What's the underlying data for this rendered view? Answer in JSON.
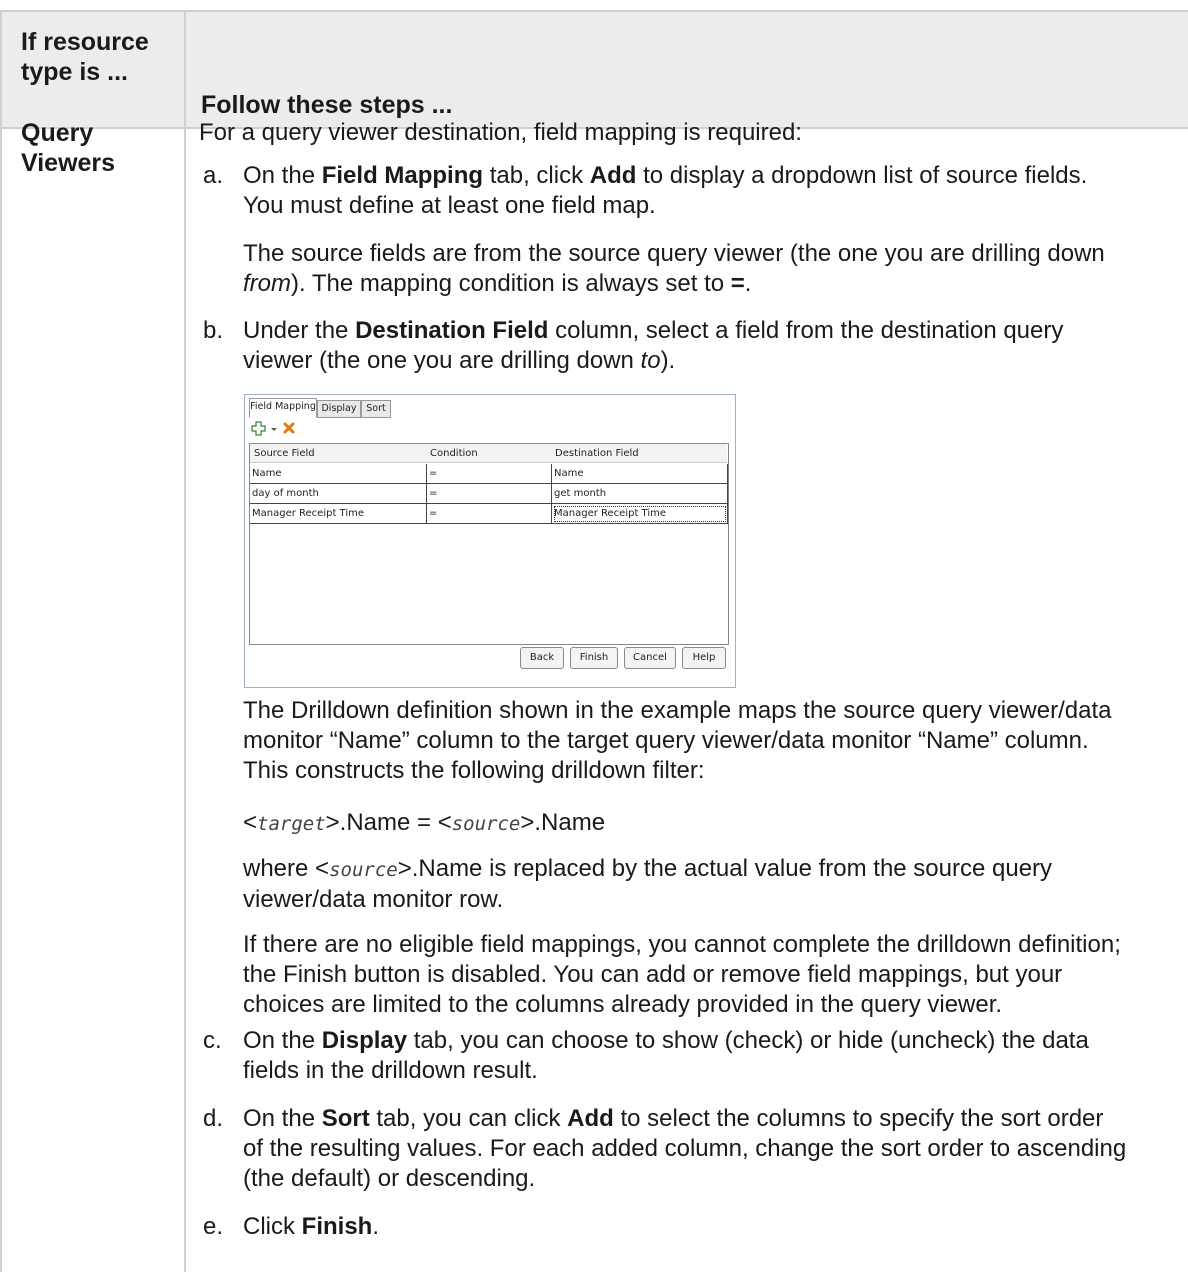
{
  "header": {
    "col1": "If resource type is ...",
    "col2": "Follow these steps ..."
  },
  "row": {
    "resource_type": "Query Viewers",
    "intro": "For a query viewer destination, field mapping is required:",
    "step_a": {
      "letter": "a.",
      "pre1": "On the ",
      "b1": "Field Mapping",
      "mid1": " tab, click ",
      "b2": "Add",
      "post1": " to display a dropdown list of source fields.",
      "line2": "You must define at least one field map.",
      "note_l1": "The source fields are from the source query viewer (the one you are drilling down",
      "note_l2_italic": "from",
      "note_l2_rest": "). The mapping condition is always set to ",
      "note_l2_bold": "=",
      "note_l2_end": "."
    },
    "step_b": {
      "letter": "b.",
      "pre1": "Under the ",
      "b1": "Destination Field",
      "post1": " column, select a field from the destination query",
      "l2_pre": "viewer (the one you are drilling down ",
      "l2_italic": "to",
      "l2_end": ")."
    },
    "dialog": {
      "tabs": [
        "Field Mapping",
        "Display",
        "Sort"
      ],
      "columns": [
        "Source Field",
        "Condition",
        "Destination Field"
      ],
      "rows": [
        [
          "Name",
          "=",
          "Name"
        ],
        [
          "day of month",
          "=",
          "get month"
        ],
        [
          "Manager Receipt Time",
          "=",
          "Manager Receipt Time"
        ]
      ],
      "buttons": [
        "Back",
        "Finish",
        "Cancel",
        "Help"
      ]
    },
    "drill_para": {
      "l1": "The Drilldown definition shown in the example maps the source query viewer/data",
      "l2": "monitor “Name” column to the target query viewer/data monitor “Name” column.",
      "l3": "This constructs the following drilldown filter:"
    },
    "filter": {
      "lt1": "<",
      "target": "target",
      "gt1": ">.Name = <",
      "source": "source",
      "gt2": ">.Name"
    },
    "where": {
      "pre": "where <",
      "source": "source",
      "post": ">.Name is replaced by the actual value from the source query",
      "l2": "viewer/data monitor row."
    },
    "no_elig": {
      "l1": "If there are no eligible field mappings, you cannot complete the drilldown definition;",
      "l2": "the Finish button is disabled. You can add or remove field mappings, but your",
      "l3": "choices are limited to the columns already provided in the query viewer."
    },
    "step_c": {
      "letter": "c.",
      "pre": "On the ",
      "b1": "Display",
      "post": " tab, you can choose to show (check) or hide (uncheck) the data",
      "l2": "fields in the drilldown result."
    },
    "step_d": {
      "letter": "d.",
      "pre": "On the ",
      "b1": "Sort",
      "mid": " tab, you can click ",
      "b2": "Add",
      "post": " to select the columns to specify the sort order",
      "l2": "of the resulting values. For each added column, change the sort order to ascending",
      "l3": "(the default) or descending."
    },
    "step_e": {
      "letter": "e.",
      "pre": "Click ",
      "b1": "Finish",
      "end": "."
    }
  }
}
